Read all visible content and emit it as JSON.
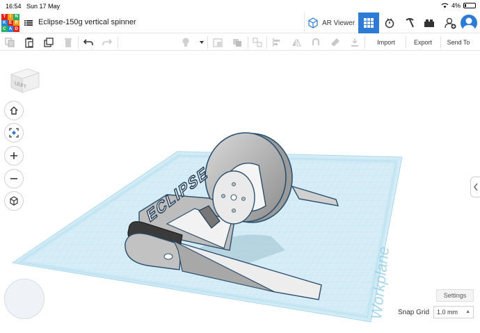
{
  "status_bar": {
    "time": "16:54",
    "date": "Sun 17 May",
    "battery": "4%"
  },
  "header": {
    "logo_letters": [
      "T",
      "I",
      "N",
      "K",
      "E",
      "R",
      "C",
      "A",
      "D"
    ],
    "logo_colors": [
      "#e2231a",
      "#f39c12",
      "#27ae60",
      "#1e88e5",
      "#e2231a",
      "#f39c12",
      "#27ae60",
      "#1e88e5",
      "#e2231a"
    ],
    "design_title": "Eclipse-150g vertical spinner",
    "ar_viewer_label": "AR Viewer",
    "accent_color": "#2e7bd6"
  },
  "toolbar": {
    "import_label": "Import",
    "export_label": "Export",
    "send_to_label": "Send To"
  },
  "viewcube": {
    "face_label": "LEFT"
  },
  "workplane": {
    "label": "Workplane",
    "logo_text": "ECLIPSE",
    "grid_color": "#a9d9ec"
  },
  "bottom": {
    "settings_label": "Settings",
    "snap_grid_label": "Snap Grid",
    "snap_grid_value": "1.0 mm"
  }
}
